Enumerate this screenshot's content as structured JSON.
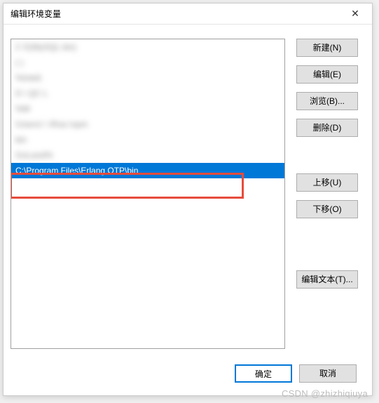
{
  "dialog": {
    "title": "编辑环境变量",
    "close_label": "✕"
  },
  "list": {
    "items": [
      {
        "text": "C                            E(MySQL         bin)",
        "blurred": true
      },
      {
        "text": "(                                   )",
        "blurred": true
      },
      {
        "text": "%Intell.",
        "blurred": true
      },
      {
        "text": "D \\  QC    L                        ",
        "blurred": true
      },
      {
        "text": "%M                                   ",
        "blurred": true
      },
      {
        "text": "\\Users\\        \\   \\Roa    \\npm",
        "blurred": true
      },
      {
        "text": "                        bin",
        "blurred": true
      },
      {
        "text": "  GoLand% ",
        "blurred": true
      },
      {
        "text": "C:\\Program Files\\Erlang OTP\\bin",
        "blurred": false,
        "selected": true
      }
    ]
  },
  "buttons": {
    "new": "新建(N)",
    "edit": "编辑(E)",
    "browse": "浏览(B)...",
    "delete": "删除(D)",
    "move_up": "上移(U)",
    "move_down": "下移(O)",
    "edit_text": "编辑文本(T)..."
  },
  "footer": {
    "ok": "确定",
    "cancel": "取消"
  },
  "watermark": "CSDN @zhizhiqiuya"
}
